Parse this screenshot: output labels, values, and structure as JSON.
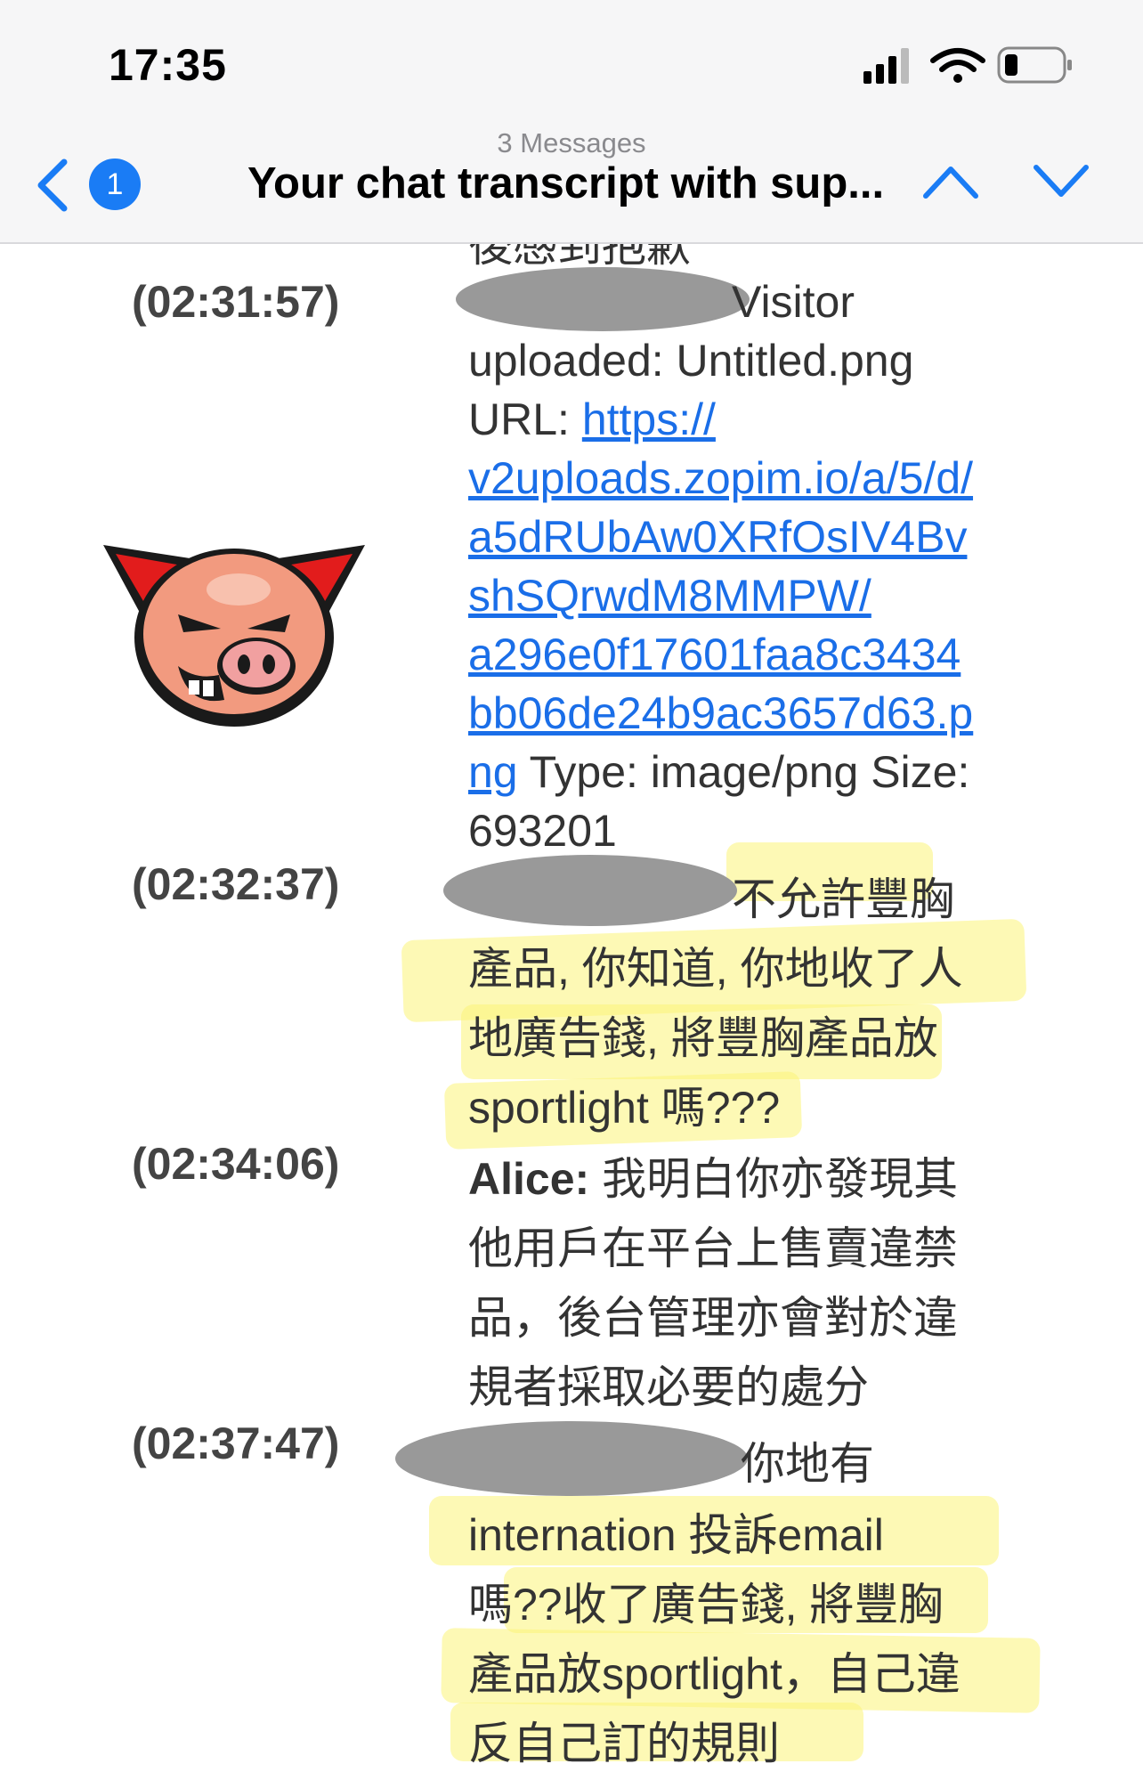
{
  "status_bar": {
    "time": "17:35"
  },
  "header": {
    "subtitle": "3 Messages",
    "title": "Your chat transcript with sup...",
    "unread_count": "1"
  },
  "transcript": {
    "cut_off_line": "後感到抱歉",
    "messages": [
      {
        "timestamp": "(02:31:57)",
        "sender": "Visitor",
        "text_before_link": "uploaded: Untitled.png",
        "url_label": "URL:",
        "url_lines": [
          "https://",
          "v2uploads.zopim.io/a/5/d/",
          "a5dRUbAw0XRfOsIV4Bv",
          "shSQrwdM8MMPW/",
          "a296e0f17601faa8c3434",
          "bb06de24b9ac3657d63.p",
          "ng"
        ],
        "after_link": "Type: image/png Size:",
        "size_value": "693201"
      },
      {
        "timestamp": "(02:32:37)",
        "lines": [
          "不允許豐胸",
          "產品, 你知道, 你地收了人",
          "地廣告錢, 將豐胸產品放",
          "sportlight 嗎???"
        ]
      },
      {
        "timestamp": "(02:34:06)",
        "sender": "Alice:",
        "lines": [
          "我明白你亦發現其",
          "他用戶在平台上售賣違禁",
          "品，後台管理亦會對於違",
          "規者採取必要的處分"
        ]
      },
      {
        "timestamp": "(02:37:47)",
        "lines": [
          "你地有",
          "internation 投訴email",
          "嗎??收了廣告錢, 將豐胸",
          "產品放sportlight，自己違",
          "反自己訂的規則"
        ]
      }
    ]
  },
  "icons": [
    "signal-icon",
    "wifi-icon",
    "battery-icon",
    "back-chevron-icon",
    "chevron-up-icon",
    "chevron-down-icon",
    "pig-avatar-icon"
  ],
  "colors": {
    "accent": "#1a7cf5",
    "link": "#1a6ee8",
    "highlight": "#fcf478",
    "redaction": "#999999"
  }
}
